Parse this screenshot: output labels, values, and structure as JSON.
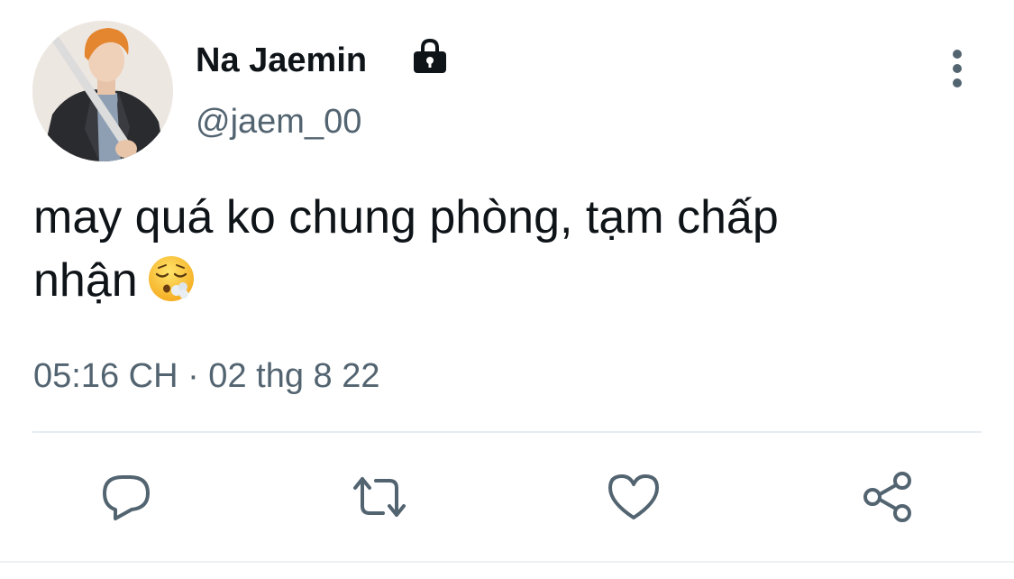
{
  "tweet": {
    "author": {
      "display_name": "Na Jaemin",
      "handle": "@jaem_00",
      "avatar_icon": "profile-photo",
      "protected_icon": "lock-icon"
    },
    "text_lines": [
      "may quá ko chung phòng, tạm chấp",
      "nhận"
    ],
    "emoji": "face-exhaling-emoji",
    "timestamp": "05:16 CH · 02 thg 8 22"
  },
  "actions": {
    "reply_icon": "reply-icon",
    "retweet_icon": "retweet-icon",
    "like_icon": "heart-icon",
    "share_icon": "share-icon"
  },
  "colors": {
    "text": "#0f1419",
    "secondary": "#536471",
    "icon": "#536471",
    "divider": "#e6ecf0"
  }
}
